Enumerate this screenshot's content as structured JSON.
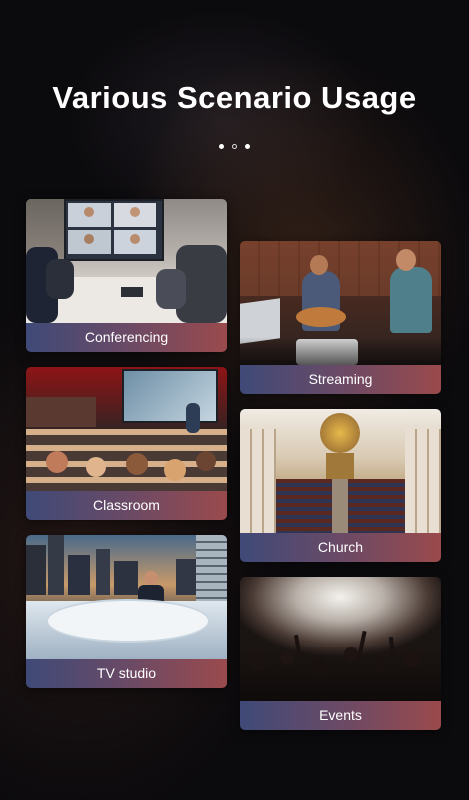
{
  "page": {
    "title": "Various Scenario Usage",
    "pagination": {
      "total": 3,
      "active": 2
    }
  },
  "scenarios": [
    {
      "label": "Conferencing",
      "icon": "conferencing-photo"
    },
    {
      "label": "Streaming",
      "icon": "streaming-photo"
    },
    {
      "label": "Classroom",
      "icon": "classroom-photo"
    },
    {
      "label": "Church",
      "icon": "church-photo"
    },
    {
      "label": "TV studio",
      "icon": "tv-studio-photo"
    },
    {
      "label": "Events",
      "icon": "events-photo"
    }
  ],
  "colors": {
    "background": "#0b0a0d",
    "caption_gradient_start": "#3f4a78",
    "caption_gradient_end": "#9a4a4c"
  }
}
